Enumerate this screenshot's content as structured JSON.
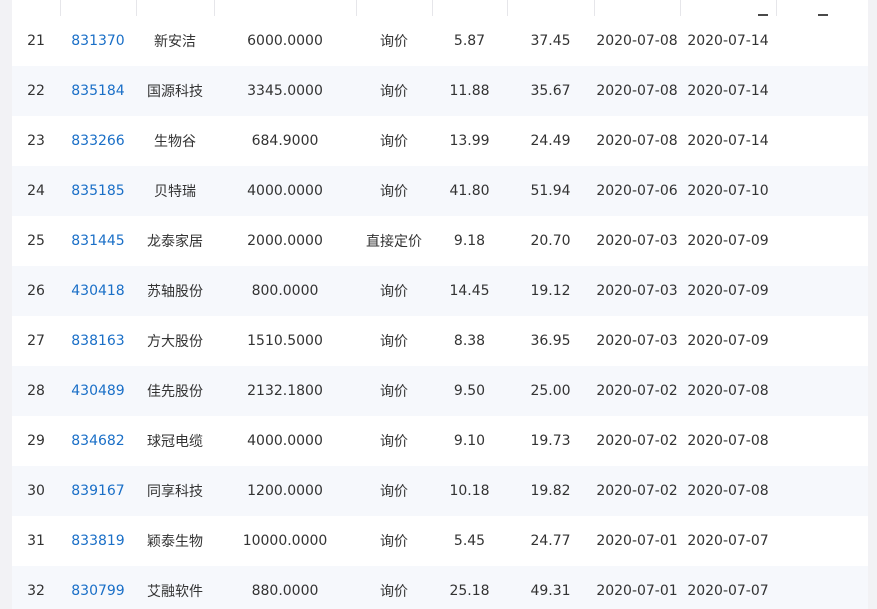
{
  "table": {
    "rows": [
      {
        "no": "21",
        "code": "831370",
        "name": "新安洁",
        "shares": "6000.0000",
        "method": "询价",
        "price": "5.87",
        "pe": "37.45",
        "date_start": "2020-07-08",
        "date_end": "2020-07-14"
      },
      {
        "no": "22",
        "code": "835184",
        "name": "国源科技",
        "shares": "3345.0000",
        "method": "询价",
        "price": "11.88",
        "pe": "35.67",
        "date_start": "2020-07-08",
        "date_end": "2020-07-14"
      },
      {
        "no": "23",
        "code": "833266",
        "name": "生物谷",
        "shares": "684.9000",
        "method": "询价",
        "price": "13.99",
        "pe": "24.49",
        "date_start": "2020-07-08",
        "date_end": "2020-07-14"
      },
      {
        "no": "24",
        "code": "835185",
        "name": "贝特瑞",
        "shares": "4000.0000",
        "method": "询价",
        "price": "41.80",
        "pe": "51.94",
        "date_start": "2020-07-06",
        "date_end": "2020-07-10"
      },
      {
        "no": "25",
        "code": "831445",
        "name": "龙泰家居",
        "shares": "2000.0000",
        "method": "直接定价",
        "price": "9.18",
        "pe": "20.70",
        "date_start": "2020-07-03",
        "date_end": "2020-07-09"
      },
      {
        "no": "26",
        "code": "430418",
        "name": "苏轴股份",
        "shares": "800.0000",
        "method": "询价",
        "price": "14.45",
        "pe": "19.12",
        "date_start": "2020-07-03",
        "date_end": "2020-07-09"
      },
      {
        "no": "27",
        "code": "838163",
        "name": "方大股份",
        "shares": "1510.5000",
        "method": "询价",
        "price": "8.38",
        "pe": "36.95",
        "date_start": "2020-07-03",
        "date_end": "2020-07-09"
      },
      {
        "no": "28",
        "code": "430489",
        "name": "佳先股份",
        "shares": "2132.1800",
        "method": "询价",
        "price": "9.50",
        "pe": "25.00",
        "date_start": "2020-07-02",
        "date_end": "2020-07-08"
      },
      {
        "no": "29",
        "code": "834682",
        "name": "球冠电缆",
        "shares": "4000.0000",
        "method": "询价",
        "price": "9.10",
        "pe": "19.73",
        "date_start": "2020-07-02",
        "date_end": "2020-07-08"
      },
      {
        "no": "30",
        "code": "839167",
        "name": "同享科技",
        "shares": "1200.0000",
        "method": "询价",
        "price": "10.18",
        "pe": "19.82",
        "date_start": "2020-07-02",
        "date_end": "2020-07-08"
      },
      {
        "no": "31",
        "code": "833819",
        "name": "颖泰生物",
        "shares": "10000.0000",
        "method": "询价",
        "price": "5.45",
        "pe": "24.77",
        "date_start": "2020-07-01",
        "date_end": "2020-07-07"
      },
      {
        "no": "32",
        "code": "830799",
        "name": "艾融软件",
        "shares": "880.0000",
        "method": "询价",
        "price": "25.18",
        "pe": "49.31",
        "date_start": "2020-07-01",
        "date_end": "2020-07-07"
      }
    ]
  },
  "colors": {
    "link": "#1a6fc7",
    "text": "#333333",
    "row_odd": "#ffffff",
    "row_even": "#f6f8fc",
    "page_bg": "#f2f2f5"
  }
}
